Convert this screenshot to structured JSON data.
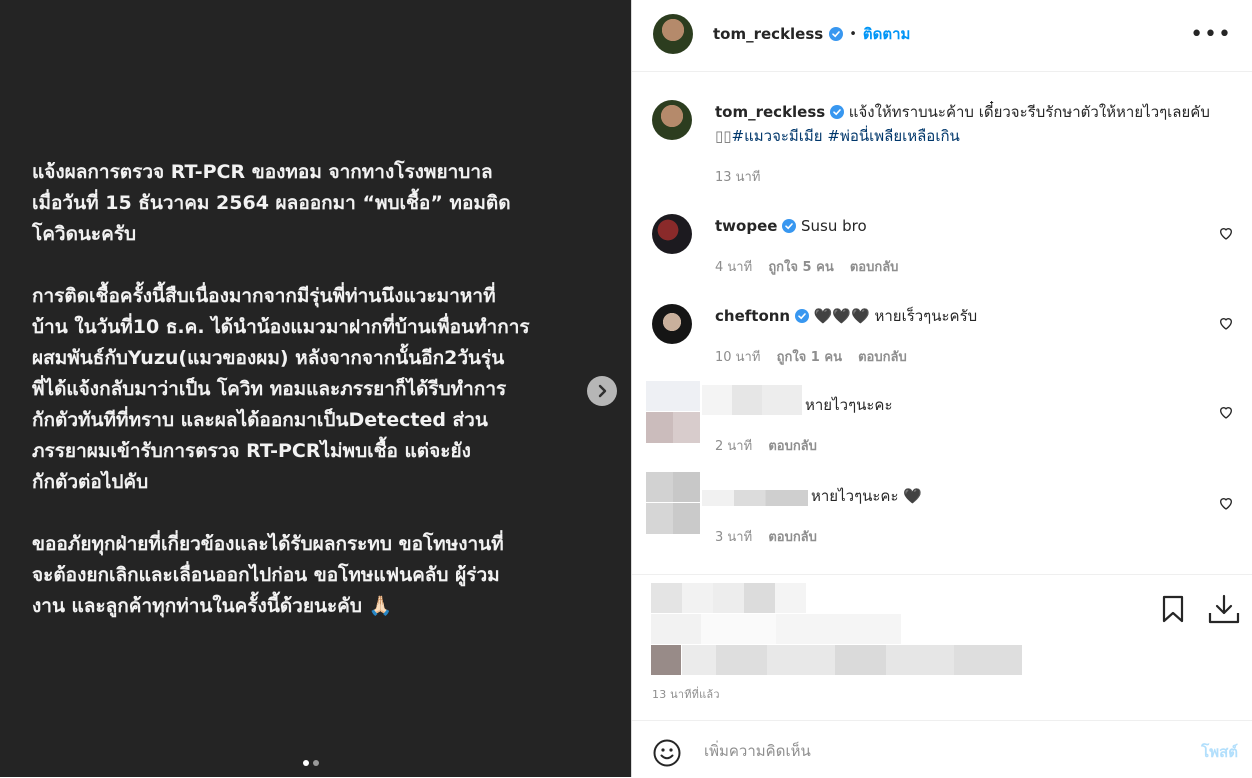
{
  "post": {
    "paragraphs": [
      "แจ้งผลการตรวจ RT-PCR ของทอม จากทางโรงพยาบาล\nเมื่อวันที่ 15 ธันวาคม 2564 ผลออกมา “พบเชื้อ” ทอมติด\nโควิดนะครับ",
      "การติดเชื้อครั้งนี้สืบเนื่องมากจากมีรุ่นพี่ท่านนึงแวะมาหาที่\nบ้าน ในวันที่10 ธ.ค. ได้นำน้องแมวมาฝากที่บ้านเพื่อนทำการ\nผสมพันธ์กับYuzu(แมวของผม) หลังจากจากนั้นอีก2วันรุ่น\nพี่ได้แจ้งกลับมาว่าเป็น โควิท ทอมและภรรยาก็ได้รีบทำการ\nกักตัวทันทีที่ทราบ และผลได้ออกมาเป็นDetected ส่วน\nภรรยาผมเข้ารับการตรวจ RT-PCRไม่พบเชื้อ แต่จะยัง\nกักตัวต่อไปคับ",
      "ขออภัยทุกฝ่ายที่เกี่ยวข้องและได้รับผลกระทบ ขอโทษงานที่\nจะต้องยกเลิกและเลื่อนออกไปก่อน ขอโทษแฟนคลับ ผู้ร่วม\nงาน และลูกค้าทุกท่านในครั้งนี้ด้วยนะคับ 🙏🏻"
    ],
    "carousel_total": 2,
    "carousel_active": 1
  },
  "header": {
    "username": "tom_reckless",
    "separator": "•",
    "follow_label": "ติดตาม",
    "more_label": "•••"
  },
  "caption": {
    "username": "tom_reckless",
    "text": "แจ้งให้ทราบนะค้าบ เดี๋ยวจะรีบรักษาตัวให้หายไวๆเลยคับ",
    "icons": "▯▯",
    "hashtag1": "#แมวจะมีเมีย",
    "hashtag2": "#พ่อนี่เพลียเหลือเกิน",
    "time": "13 นาที"
  },
  "comments": [
    {
      "username": "twopee",
      "text": "Susu bro",
      "time": "4 นาที",
      "likes": "ถูกใจ 5 คน",
      "reply": "ตอบกลับ"
    },
    {
      "username": "cheftonn",
      "text": "🖤🖤🖤 หายเร็วๆนะครับ",
      "time": "10 นาที",
      "likes": "ถูกใจ 1 คน",
      "reply": "ตอบกลับ"
    },
    {
      "username": "",
      "text": "หายไวๆนะคะ",
      "time": "2 นาที",
      "reply": "ตอบกลับ"
    },
    {
      "username": "",
      "text": "หายไวๆนะคะ 🖤",
      "time": "3 นาที",
      "reply": "ตอบกลับ"
    }
  ],
  "footer": {
    "time_ago": "13 นาทีที่แล้ว",
    "add_comment_placeholder": "เพิ่มความคิดเห็น",
    "post_label": "โพสต์"
  },
  "colors": {
    "accent": "#0095f6",
    "hashtag": "#00376b",
    "muted": "#8e8e8e"
  },
  "icons": [
    "chevron-right-icon",
    "verified-icon",
    "heart-icon",
    "bookmark-icon",
    "download-icon",
    "emoji-icon"
  ]
}
